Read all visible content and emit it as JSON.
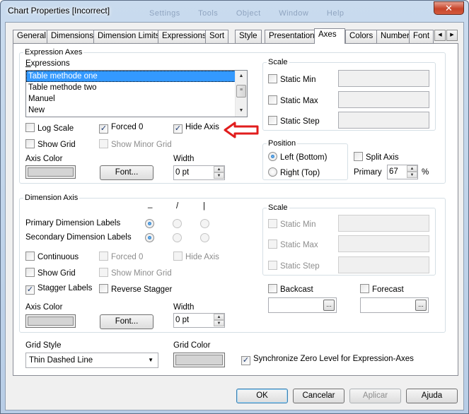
{
  "window": {
    "title": "Chart Properties [Incorrect]",
    "background_menu": [
      "Settings",
      "Tools",
      "Object",
      "Window",
      "Help"
    ],
    "close_glyph": "✕"
  },
  "tabs": [
    "General",
    "Dimensions",
    "Dimension Limits",
    "Expressions",
    "Sort",
    "Style",
    "Presentation",
    "Axes",
    "Colors",
    "Number",
    "Font"
  ],
  "active_tab": "Axes",
  "expression_axes": {
    "group_label": "Expression Axes",
    "expressions_label": "Expressions",
    "expressions": [
      "Table methode one",
      "Table methode two",
      "Manuel",
      "New"
    ],
    "selected_index": 0,
    "log_scale": "Log Scale",
    "forced0": "Forced 0",
    "hide_axis": "Hide Axis",
    "show_grid": "Show Grid",
    "show_minor_grid": "Show Minor Grid",
    "axis_color": "Axis Color",
    "font_button": "Font...",
    "width_label": "Width",
    "width_value": "0 pt",
    "scale": {
      "label": "Scale",
      "static_min": "Static Min",
      "static_max": "Static Max",
      "static_step": "Static Step"
    },
    "position": {
      "label": "Position",
      "left": "Left (Bottom)",
      "right": "Right (Top)"
    },
    "split_axis": "Split Axis",
    "primary_label": "Primary",
    "primary_value": "67",
    "percent": "%",
    "annotation_color": "#e11d1d"
  },
  "dimension_axis": {
    "group_label": "Dimension Axis",
    "col_headers": [
      "_",
      "/",
      "|"
    ],
    "primary_labels": "Primary Dimension Labels",
    "secondary_labels": "Secondary Dimension Labels",
    "continuous": "Continuous",
    "forced0": "Forced 0",
    "hide_axis": "Hide Axis",
    "show_grid": "Show Grid",
    "show_minor_grid": "Show Minor Grid",
    "stagger_labels": "Stagger Labels",
    "reverse_stagger": "Reverse Stagger",
    "axis_color": "Axis Color",
    "font_button": "Font...",
    "width_label": "Width",
    "width_value": "0 pt",
    "scale": {
      "label": "Scale",
      "static_min": "Static Min",
      "static_max": "Static Max",
      "static_step": "Static Step"
    },
    "backcast": "Backcast",
    "forecast": "Forecast"
  },
  "grid_style": {
    "label": "Grid Style",
    "value": "Thin Dashed Line"
  },
  "grid_color": {
    "label": "Grid Color"
  },
  "sync_zero": "Synchronize Zero Level for Expression-Axes",
  "buttons": {
    "ok": "OK",
    "cancel": "Cancelar",
    "apply": "Aplicar",
    "help": "Ajuda"
  }
}
